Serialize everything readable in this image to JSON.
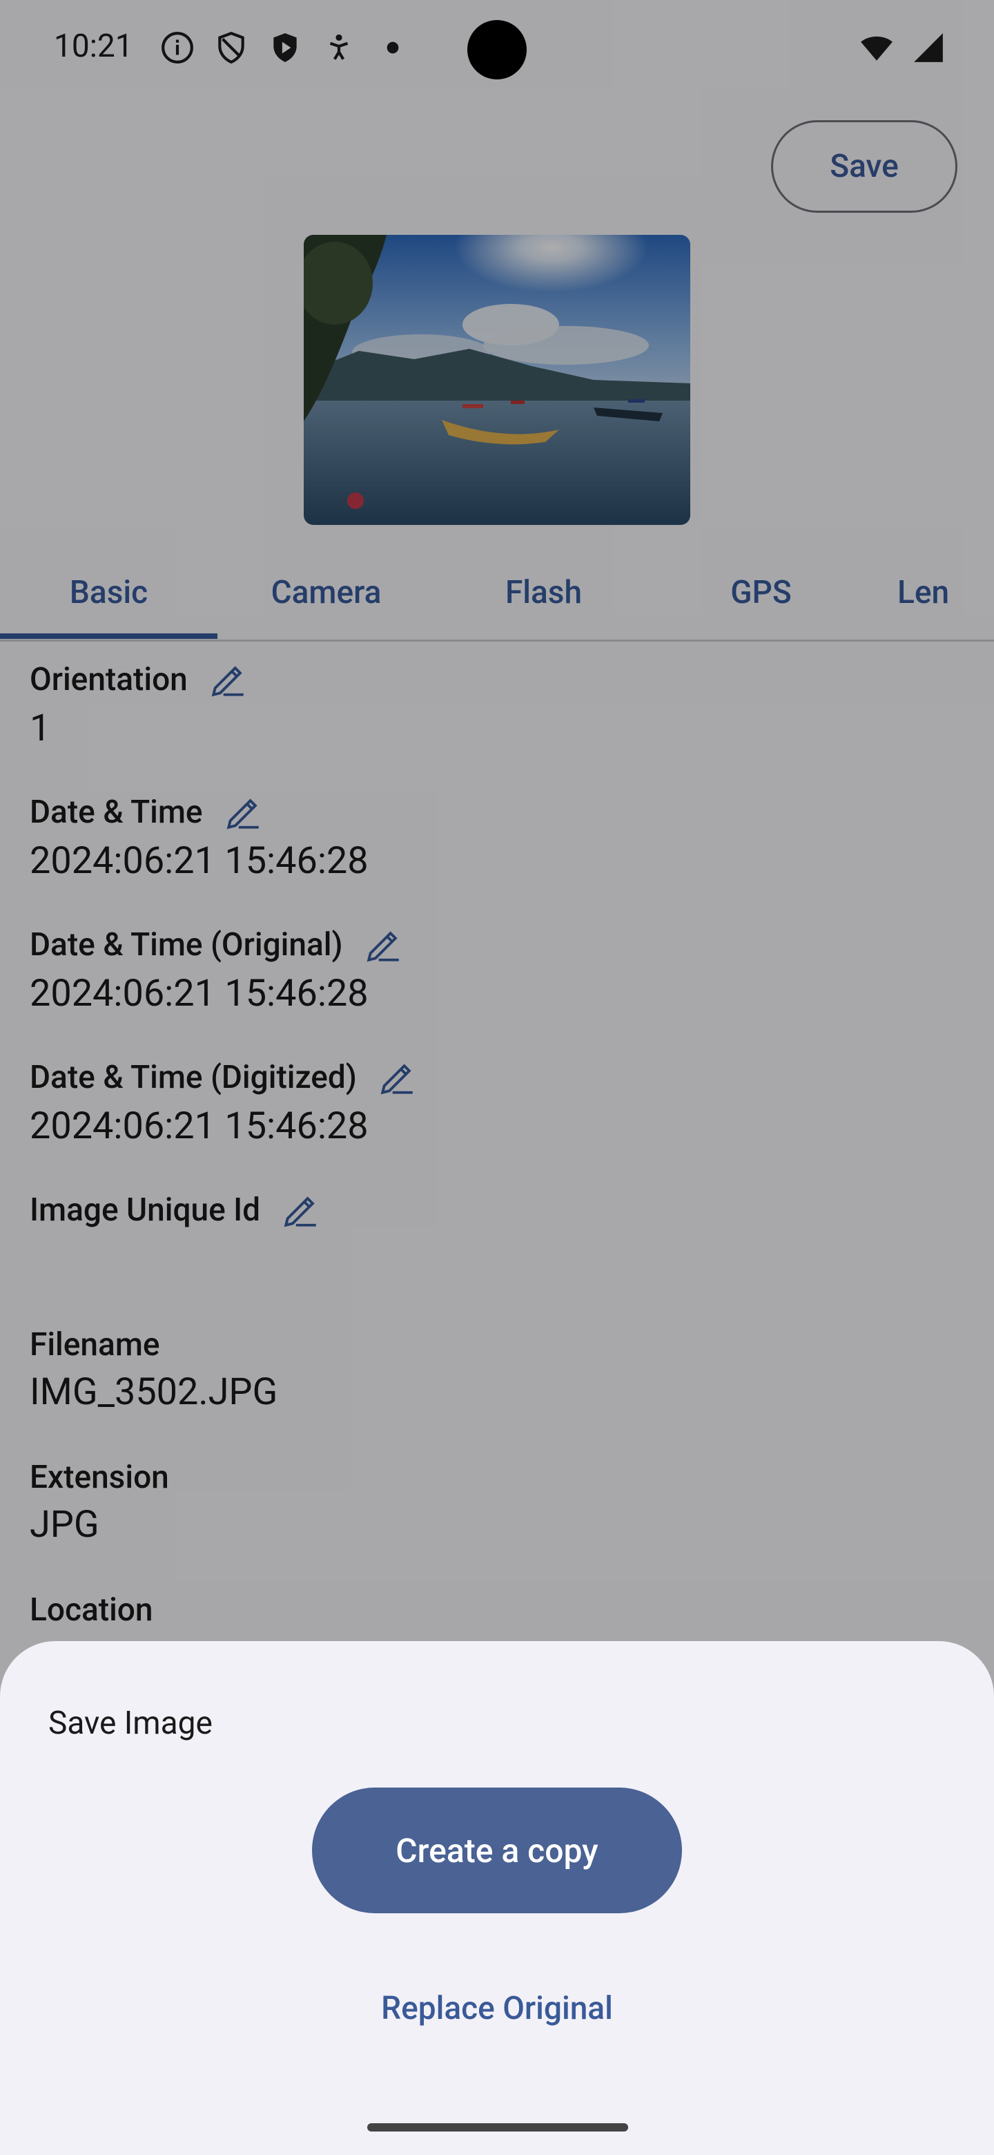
{
  "status": {
    "time": "10:21"
  },
  "toolbar": {
    "save_label": "Save"
  },
  "tabs": [
    {
      "label": "Basic"
    },
    {
      "label": "Camera"
    },
    {
      "label": "Flash"
    },
    {
      "label": "GPS"
    },
    {
      "label": "Len"
    }
  ],
  "fields": [
    {
      "label": "Orientation",
      "value": "1"
    },
    {
      "label": "Date & Time",
      "value": "2024:06:21 15:46:28"
    },
    {
      "label": "Date & Time (Original)",
      "value": "2024:06:21 15:46:28"
    },
    {
      "label": "Date & Time (Digitized)",
      "value": "2024:06:21 15:46:28"
    },
    {
      "label": "Image Unique Id",
      "value": ""
    },
    {
      "label": "Filename",
      "value": "IMG_3502.JPG"
    },
    {
      "label": "Extension",
      "value": "JPG"
    },
    {
      "label": "Location",
      "value": ""
    }
  ],
  "sheet": {
    "title": "Save Image",
    "primary": "Create a copy",
    "secondary": "Replace Original"
  },
  "colors": {
    "accent": "#375a9b",
    "primary_button": "#4a6294",
    "scrim": "rgba(0,0,0,0.32)"
  },
  "icons": [
    "info-icon",
    "shield-icon",
    "shield-filled-icon",
    "accessibility-icon",
    "dot-icon",
    "wifi-icon",
    "signal-icon",
    "edit-icon"
  ]
}
